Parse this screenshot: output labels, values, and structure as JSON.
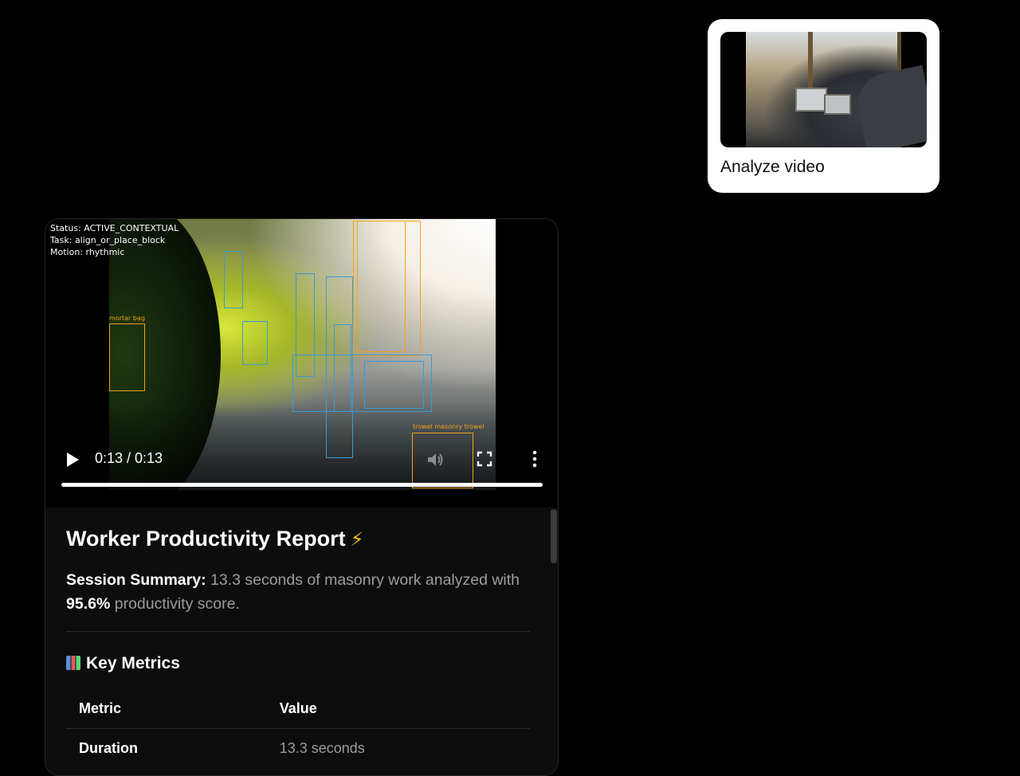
{
  "upload": {
    "label": "Analyze video"
  },
  "video": {
    "overlay": {
      "status": "Status: ACTIVE_CONTEXTUAL",
      "task": "Task: align_or_place_block",
      "motion": "Motion: rhythmic"
    },
    "detections": [
      {
        "label": "mortar bag",
        "color": "orange"
      },
      {
        "label": "trowel masonry trowel",
        "color": "orange"
      }
    ],
    "time": "0:13 / 0:13",
    "progress": 1.0
  },
  "report": {
    "title": "Worker Productivity Report",
    "summary_label": "Session Summary:",
    "summary_text": "13.3 seconds of masonry work analyzed with",
    "score": "95.6%",
    "score_suffix": "productivity score.",
    "metrics_title": "Key Metrics",
    "table": {
      "headers": [
        "Metric",
        "Value"
      ],
      "rows": [
        {
          "metric": "Duration",
          "value": "13.3 seconds"
        }
      ]
    }
  }
}
